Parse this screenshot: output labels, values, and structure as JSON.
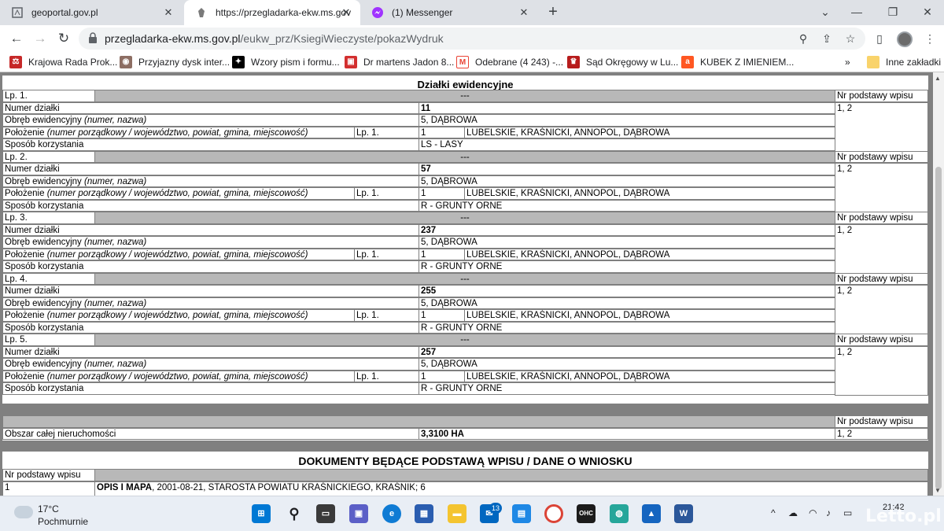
{
  "tabs": [
    {
      "title": "geoportal.gov.pl",
      "icon": "geoportal-icon"
    },
    {
      "title": "https://przegladarka-ekw.ms.gov",
      "icon": "government-eagle-icon"
    },
    {
      "title": "(1) Messenger",
      "icon": "messenger-icon"
    }
  ],
  "toolbar": {
    "url_host": "przegladarka-ekw.ms.gov.pl",
    "url_path": "/eukw_prz/KsiegiWieczyste/pokazWydruk"
  },
  "bookmarks": [
    {
      "label": "Krajowa Rada Prok...",
      "color": "#c62828"
    },
    {
      "label": "Przyjazny dysk inter...",
      "color": "#8d6e63"
    },
    {
      "label": "Wzory pism i formu...",
      "color": "#000000"
    },
    {
      "label": "Dr martens Jadon 8...",
      "color": "#d32f2f"
    },
    {
      "label": "Odebrane (4 243) -...",
      "color": "#ea4335"
    },
    {
      "label": "Sąd Okręgowy w Lu...",
      "color": "#b71c1c"
    },
    {
      "label": "KUBEK Z IMIENIEM...",
      "color": "#ff5722"
    },
    {
      "label": "Inne zakładki",
      "color": "#f9d36b"
    }
  ],
  "doc": {
    "section_title": "Działki ewidencyjne",
    "labels": {
      "numer": "Numer działki",
      "obreb_pre": "Obręb ewidencyjny ",
      "obreb_it": "(numer, nazwa)",
      "polozenie_pre": "Położenie ",
      "polozenie_it": "(numer porządkowy / województwo, powiat, gmina, miejscowość)",
      "sposob": "Sposób korzystania",
      "nr_podstawy": "Nr podstawy wpisu",
      "dashes": "---",
      "lp_ref": "Lp. 1."
    },
    "parcels": [
      {
        "lp": "Lp. 1.",
        "numer": "11",
        "obreb": "5, DĄBROWA",
        "poz_nr": "1",
        "lokalizacja": "LUBELSKIE, KRAŚNICKI, ANNOPOL, DĄBROWA",
        "sposob": "LS - LASY",
        "podstawa": "1, 2"
      },
      {
        "lp": "Lp. 2.",
        "numer": "57",
        "obreb": "5, DĄBROWA",
        "poz_nr": "1",
        "lokalizacja": "LUBELSKIE, KRAŚNICKI, ANNOPOL, DĄBROWA",
        "sposob": "R - GRUNTY ORNE",
        "podstawa": "1, 2"
      },
      {
        "lp": "Lp. 3.",
        "numer": "237",
        "obreb": "5, DĄBROWA",
        "poz_nr": "1",
        "lokalizacja": "LUBELSKIE, KRAŚNICKI, ANNOPOL, DĄBROWA",
        "sposob": "R - GRUNTY ORNE",
        "podstawa": "1, 2"
      },
      {
        "lp": "Lp. 4.",
        "numer": "255",
        "obreb": "5, DĄBROWA",
        "poz_nr": "1",
        "lokalizacja": "LUBELSKIE, KRAŚNICKI, ANNOPOL, DĄBROWA",
        "sposob": "R - GRUNTY ORNE",
        "podstawa": "1, 2"
      },
      {
        "lp": "Lp. 5.",
        "numer": "257",
        "obreb": "5, DĄBROWA",
        "poz_nr": "1",
        "lokalizacja": "LUBELSKIE, KRAŚNICKI, ANNOPOL, DĄBROWA",
        "sposob": "R - GRUNTY ORNE",
        "podstawa": "1, 2"
      }
    ],
    "obszar": {
      "label": "Obszar całej nieruchomości",
      "value": "3,3100 HA",
      "podstawa": "1, 2"
    },
    "dokumenty": {
      "title": "DOKUMENTY BĘDĄCE PODSTAWĄ WPISU / DANE O WNIOSKU",
      "header": "Nr podstawy wpisu",
      "row_nr": "1",
      "row_doc_bold": "OPIS I MAPA",
      "row_doc_rest": ", 2001-08-21, STAROSTA POWIATU KRAŚNICKIEGO, KRAŚNIK; 6"
    }
  },
  "taskbar": {
    "temp": "17°C",
    "weather": "Pochmurnie",
    "time": "21:42",
    "mail_badge": "13"
  },
  "watermark": "Letto.pl"
}
